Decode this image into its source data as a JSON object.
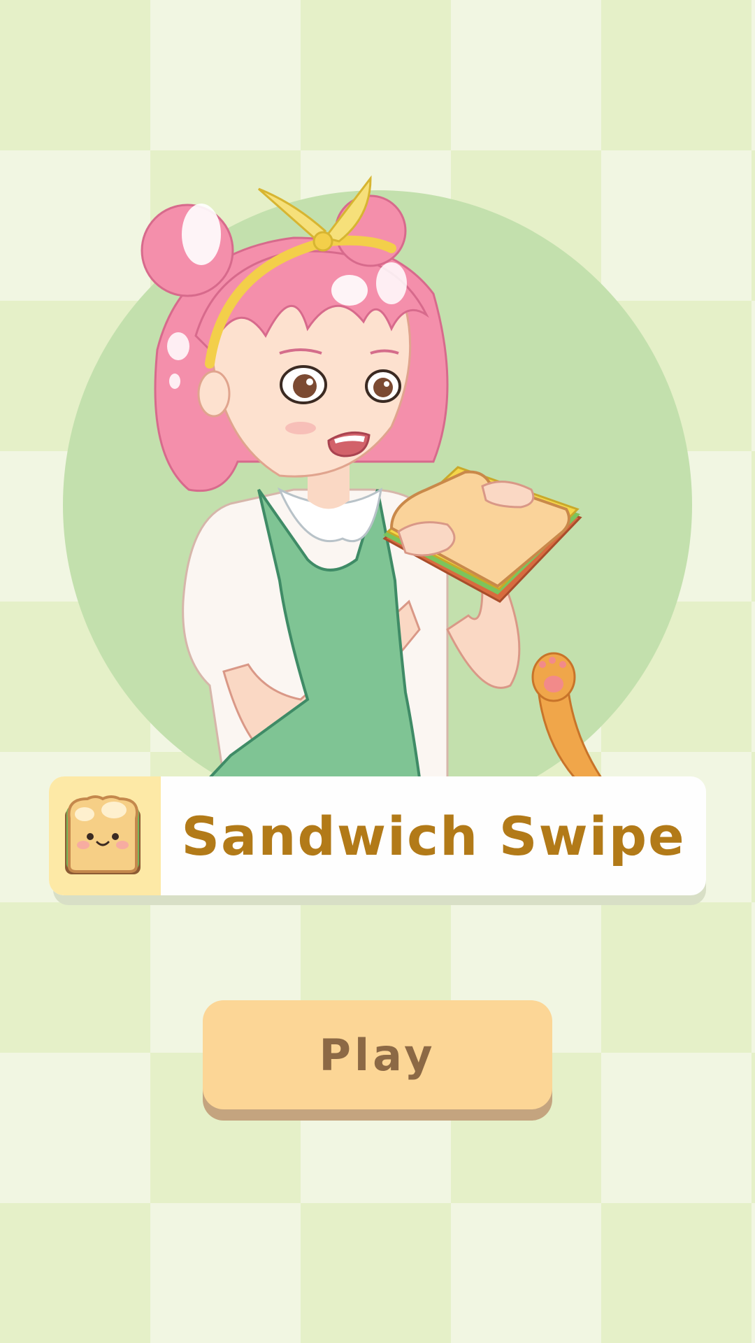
{
  "title": {
    "text": "Sandwich Swipe",
    "icon": "sandwich-toast-icon"
  },
  "play_button": {
    "label": "Play"
  },
  "illustration": {
    "subject": "girl-with-sandwich",
    "extra": "cat-paw"
  },
  "colors": {
    "background_light": "#f1f6e2",
    "background_dark": "#e5f0c8",
    "circle": "#c3e0ad",
    "title_text": "#b27a18",
    "button_fill": "#fcd696",
    "button_text": "#8c6945"
  }
}
